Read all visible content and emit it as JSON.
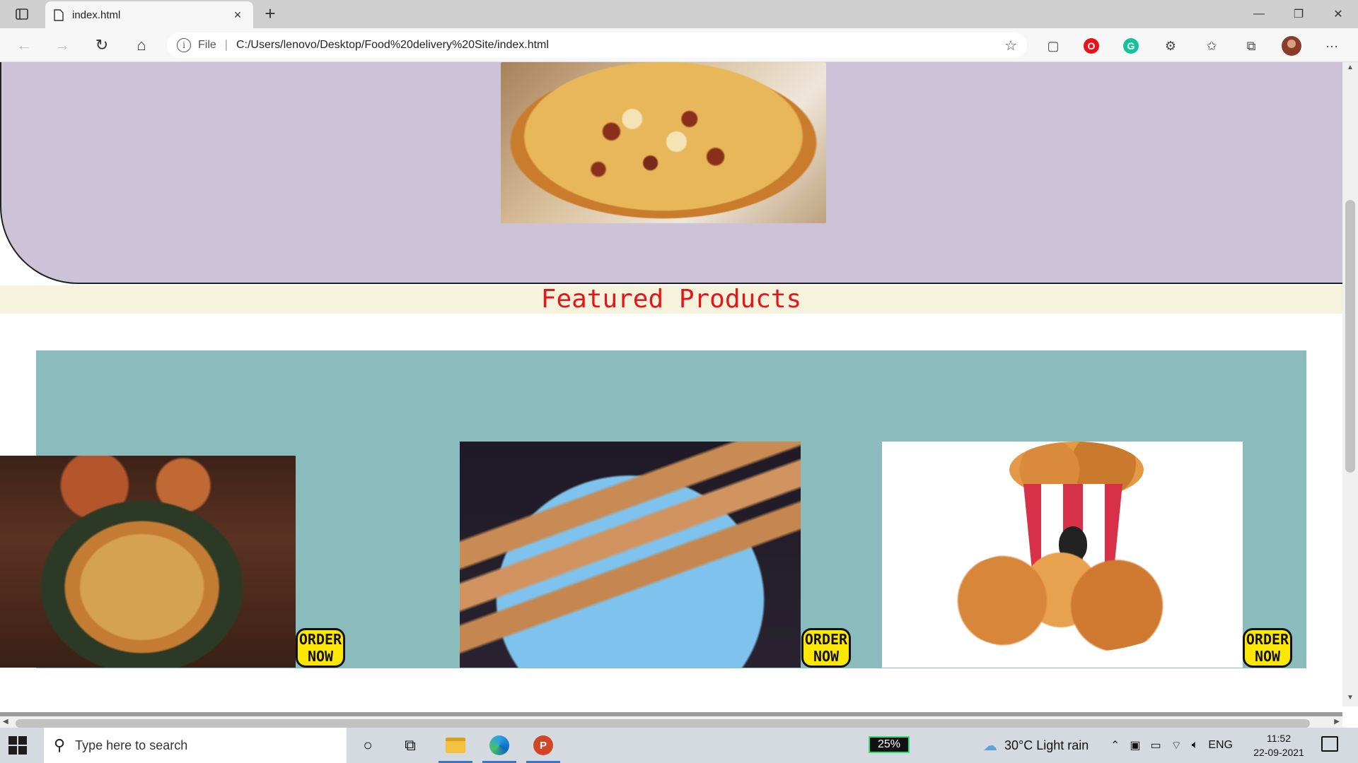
{
  "browser": {
    "tab_title": "index.html",
    "tab_close": "×",
    "new_tab": "+",
    "scheme_label": "File",
    "url": "C:/Users/lenovo/Desktop/Food%20delivery%20Site/index.html",
    "window_controls": {
      "minimize": "—",
      "restore": "❐",
      "close": "✕"
    },
    "icons": [
      "back-icon",
      "forward-icon",
      "refresh-icon",
      "home-icon",
      "info-icon",
      "favorite-add-icon",
      "extension-icon",
      "favorites-icon",
      "collections-icon",
      "more-icon"
    ]
  },
  "page": {
    "featured_title": "Featured Products",
    "products": [
      {
        "name": "biryani",
        "order_label": "ORDER NOW"
      },
      {
        "name": "kathi-roll",
        "order_label": "ORDER NOW"
      },
      {
        "name": "fried-chicken-bucket",
        "order_label": "ORDER NOW"
      }
    ],
    "colors": {
      "hero_bg": "#cdc3d8",
      "featured_bar_bg": "#f5f3dc",
      "featured_title": "#e8141b",
      "products_bg": "#8bbcbd",
      "order_button_bg": "#ffe800"
    }
  },
  "taskbar": {
    "search_placeholder": "Type here to search",
    "battery": "25%",
    "weather": "30°C  Light rain",
    "language": "ENG",
    "time": "11:52",
    "date": "22-09-2021"
  }
}
